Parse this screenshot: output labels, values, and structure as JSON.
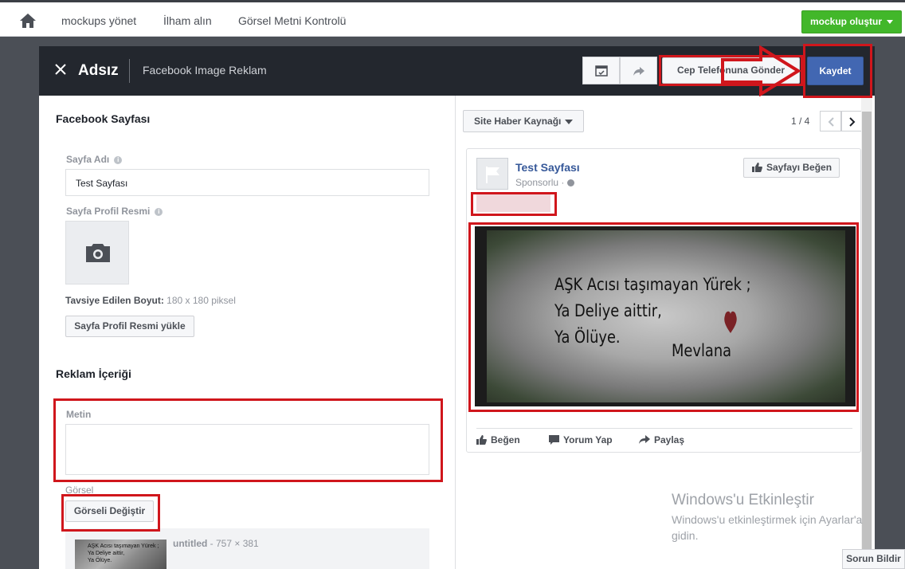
{
  "topnav": {
    "links": [
      "mockups yönet",
      "İlham alın",
      "Görsel Metni Kontrolü"
    ],
    "create_label": "mockup oluştur"
  },
  "editor": {
    "title": "Adsız",
    "type": "Facebook Image Reklam",
    "send_label": "Cep Telefonuna Gönder",
    "save_label": "Kaydet"
  },
  "left": {
    "section_page": "Facebook Sayfası",
    "page_name_label": "Sayfa Adı",
    "page_name_value": "Test Sayfası",
    "profile_label": "Sayfa Profil Resmi",
    "hint_bold": "Tavsiye Edilen Boyut:",
    "hint_value": "180 x 180 piksel",
    "upload_label": "Sayfa Profil Resmi yükle",
    "section_content": "Reklam İçeriği",
    "text_label": "Metin",
    "image_label": "Görsel",
    "change_image_label": "Görseli Değiştir",
    "thumb_name": "untitled",
    "thumb_size": " - 757 × 381",
    "thumb_lines": [
      "AŞK Acısı taşımayan Yürek ;",
      "Ya Deliye aittir,",
      "Ya Ölüye."
    ]
  },
  "right": {
    "feed_select": "Site Haber Kaynağı",
    "pager": "1 / 4",
    "page_name": "Test Sayfası",
    "sponsored": "Sponsorlu · ",
    "like_page": "Sayfayı Beğen",
    "ad_lines": [
      "AŞK Acısı taşımayan Yürek ;",
      "Ya Deliye aittir,",
      "Ya Ölüye.",
      "Mevlana"
    ],
    "actions": [
      "Beğen",
      "Yorum Yap",
      "Paylaş"
    ]
  },
  "watermark": {
    "title": "Windows'u Etkinleştir",
    "subtitle": "Windows'u etkinleştirmek için Ayarlar'a gidin."
  },
  "report_label": "Sorun Bildir",
  "colors": {
    "save_blue": "#4267b2",
    "create_green": "#42b72a",
    "annotation_red": "#d0161c",
    "header_dark": "#23272e"
  }
}
